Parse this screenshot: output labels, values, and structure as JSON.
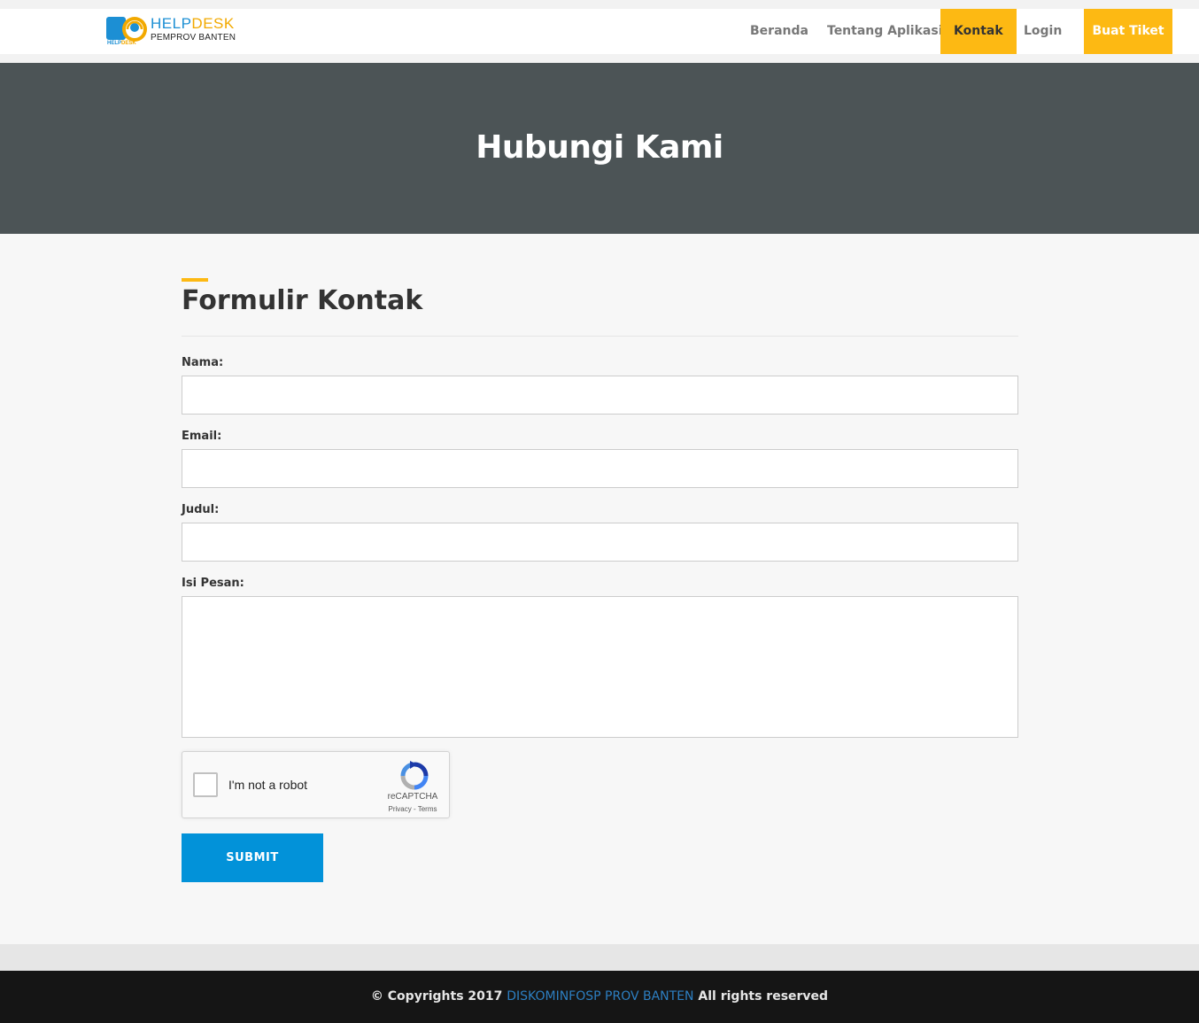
{
  "header": {
    "logo": {
      "word_help": "HELP",
      "word_desk": "DESK",
      "subtitle": "PEMPROV BANTEN",
      "badge": "HELPDESK"
    },
    "nav": [
      {
        "label": "Beranda",
        "active": false
      },
      {
        "label": "Tentang Aplikasi",
        "active": false
      },
      {
        "label": "Kontak",
        "active": true
      },
      {
        "label": "Login",
        "active": false
      }
    ],
    "cta_label": "Buat Tiket"
  },
  "hero": {
    "title": "Hubungi Kami"
  },
  "form": {
    "title": "Formulir Kontak",
    "fields": {
      "nama_label": "Nama:",
      "nama_value": "",
      "email_label": "Email:",
      "email_value": "",
      "judul_label": "Judul:",
      "judul_value": "",
      "pesan_label": "Isi Pesan:",
      "pesan_value": ""
    },
    "captcha": {
      "label": "I'm not a robot",
      "brand": "reCAPTCHA",
      "terms": "Privacy - Terms"
    },
    "submit_label": "SUBMIT"
  },
  "footer": {
    "prefix": "© Copyrights 2017",
    "org": "DISKOMINFOSP PROV BANTEN",
    "suffix": "All rights reserved"
  },
  "colors": {
    "accent": "#fdb913",
    "hero_bg": "#4c5456",
    "submit_bg": "#0292d9",
    "footer_bg": "#151515",
    "link": "#2d7fc2"
  },
  "icons": {
    "logo": "helpdesk-headset-icon",
    "captcha": "recaptcha-icon"
  }
}
